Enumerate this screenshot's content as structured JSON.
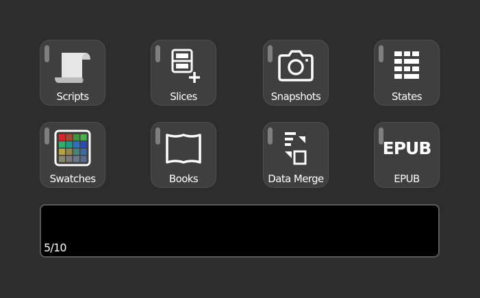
{
  "tiles": [
    {
      "label": "Scripts",
      "icon": "scroll-icon"
    },
    {
      "label": "Slices",
      "icon": "slices-add-icon"
    },
    {
      "label": "Snapshots",
      "icon": "camera-icon"
    },
    {
      "label": "States",
      "icon": "states-list-icon"
    },
    {
      "label": "Swatches",
      "icon": "swatches-grid-icon"
    },
    {
      "label": "Books",
      "icon": "book-icon"
    },
    {
      "label": "Data Merge",
      "icon": "data-merge-icon"
    },
    {
      "label": "EPUB",
      "icon": "epub-text-icon",
      "icon_text": "EPUB"
    }
  ],
  "display": {
    "page_indicator": "5/10"
  },
  "colors": {
    "background": "#2d2d2d",
    "tile": "#3f3f3f",
    "tile_border": "#505050",
    "led": "#7f7f7f",
    "display": "#000000",
    "text": "#ffffff"
  },
  "swatch_colors": [
    "#d9262b",
    "#a64a2e",
    "#3a9a3a",
    "#49b14a",
    "#2db06e",
    "#1a9e86",
    "#2c6fc7",
    "#2b49b8",
    "#b8a23a",
    "#8f8a4a",
    "#3a8a7a",
    "#3a6aa8",
    "#8a8a6a",
    "#7a7a7a",
    "#6a7a8a",
    "#5a6a8a"
  ]
}
